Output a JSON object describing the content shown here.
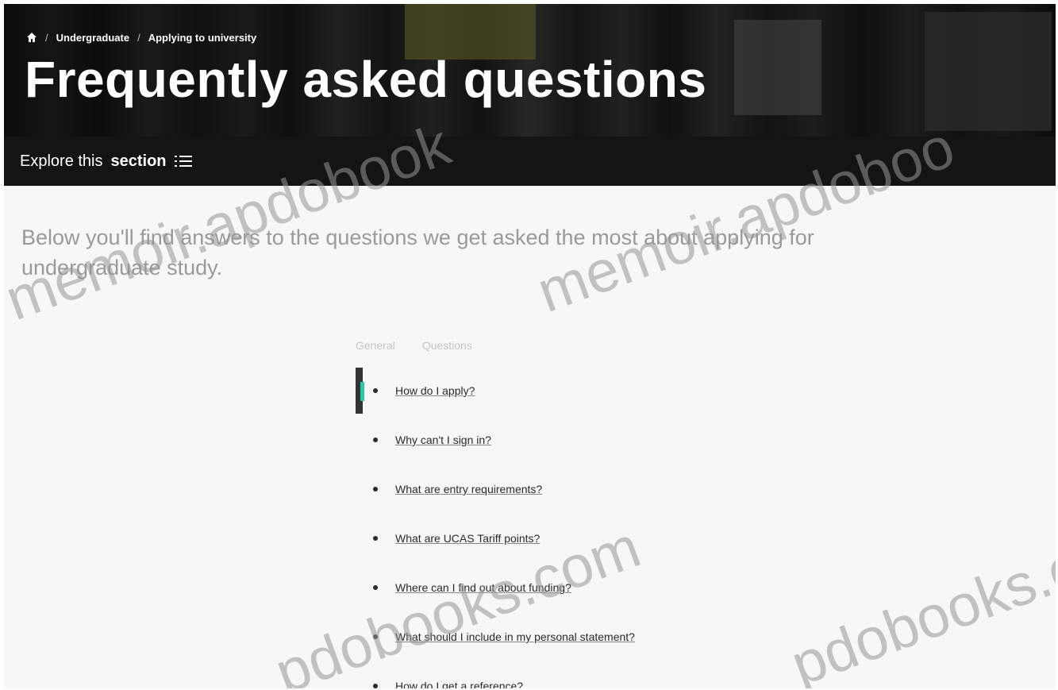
{
  "breadcrumb": {
    "home_icon": "home-icon",
    "items": [
      "Undergraduate",
      "Applying to university"
    ]
  },
  "page_title": "Frequently asked questions",
  "explore": {
    "prefix": "Explore this",
    "emphasis": "section",
    "icon": "menu-list-icon"
  },
  "intro": "Below you'll find answers to the questions we get asked the most about applying for undergraduate study.",
  "tabs": [
    "General",
    "Questions"
  ],
  "faq": [
    "How do I apply?",
    "Why can't I sign in?",
    "What are entry requirements?",
    "What are UCAS Tariff points?",
    "Where can I find out about funding?",
    "What should I include in my personal statement?",
    "How do I get a reference?"
  ],
  "watermark": {
    "top": "memoir.apdobook",
    "top_right": "memoir.apdoboo",
    "bottom": "pdobooks.com",
    "bottom_right": "pdobooks.com"
  },
  "colors": {
    "accent": "#2cc7a6",
    "hero_dark": "#141414"
  }
}
